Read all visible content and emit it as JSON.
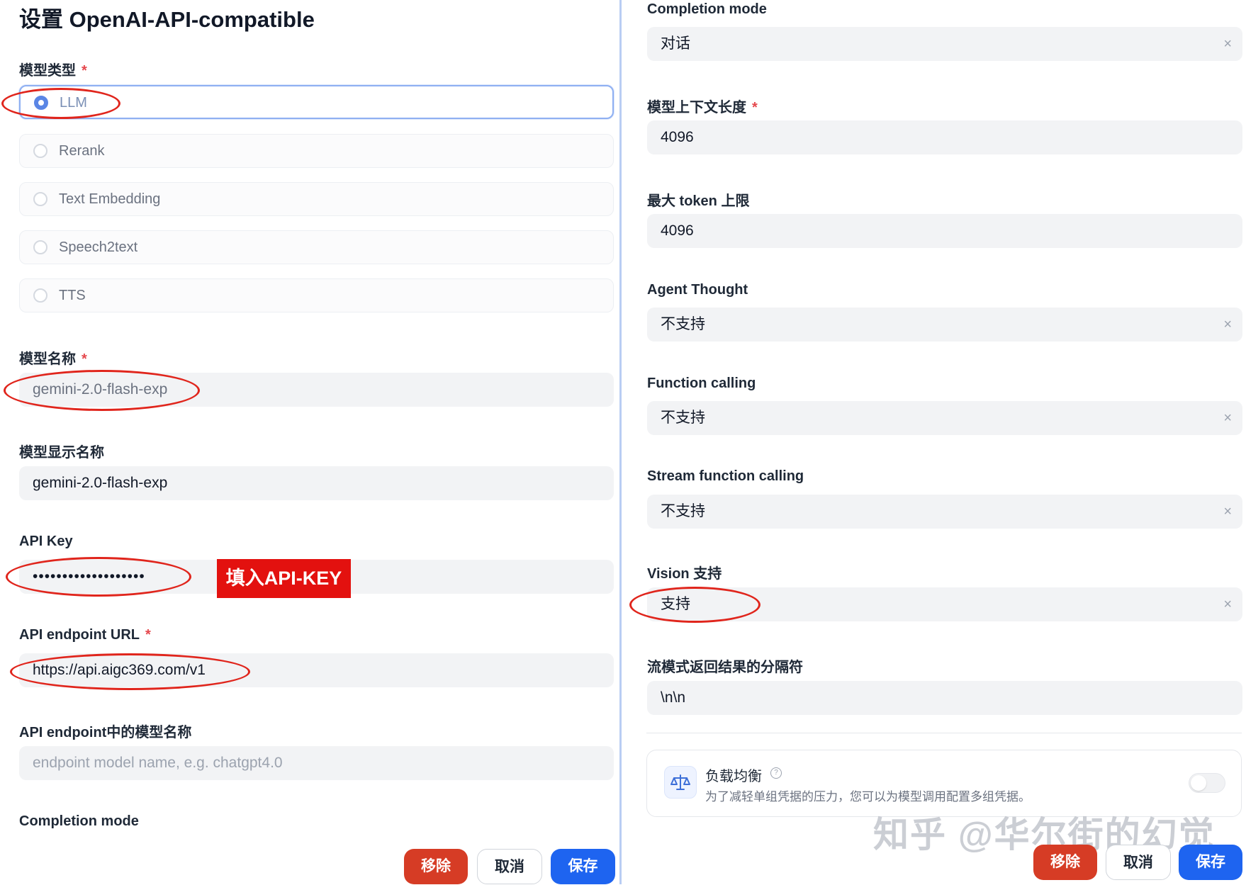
{
  "left": {
    "title": "设置 OpenAI-API-compatible",
    "model_type": {
      "label": "模型类型",
      "options": [
        {
          "label": "LLM",
          "selected": true
        },
        {
          "label": "Rerank",
          "selected": false
        },
        {
          "label": "Text Embedding",
          "selected": false
        },
        {
          "label": "Speech2text",
          "selected": false
        },
        {
          "label": "TTS",
          "selected": false
        }
      ]
    },
    "model_name": {
      "label": "模型名称",
      "value": "gemini-2.0-flash-exp"
    },
    "display_name": {
      "label": "模型显示名称",
      "value": "gemini-2.0-flash-exp"
    },
    "api_key": {
      "label": "API Key",
      "value": "•••••••••••••••••••",
      "callout": "填入API-KEY"
    },
    "endpoint_url": {
      "label": "API endpoint URL",
      "value": "https://api.aigc369.com/v1"
    },
    "endpoint_model": {
      "label": "API endpoint中的模型名称",
      "placeholder": "endpoint model name, e.g. chatgpt4.0"
    },
    "completion_mode_label": "Completion mode",
    "buttons": {
      "remove": "移除",
      "cancel": "取消",
      "save": "保存"
    }
  },
  "right": {
    "completion_mode": {
      "label": "Completion mode",
      "value": "对话"
    },
    "context_length": {
      "label": "模型上下文长度",
      "value": "4096"
    },
    "max_tokens": {
      "label": "最大 token 上限",
      "value": "4096"
    },
    "agent_thought": {
      "label": "Agent Thought",
      "value": "不支持"
    },
    "function_calling": {
      "label": "Function calling",
      "value": "不支持"
    },
    "stream_function_calling": {
      "label": "Stream function calling",
      "value": "不支持"
    },
    "vision": {
      "label": "Vision 支持",
      "value": "支持"
    },
    "stream_delimiter": {
      "label": "流模式返回结果的分隔符",
      "value": "\\n\\n"
    },
    "load_balance": {
      "title": "负载均衡",
      "help": "?",
      "description": "为了减轻单组凭据的压力，您可以为模型调用配置多组凭据。",
      "enabled": false
    },
    "buttons": {
      "remove": "移除",
      "cancel": "取消",
      "save": "保存"
    },
    "required_mark": "*",
    "clear_symbol": "×"
  },
  "watermark": "知乎 @华尔街的幻觉",
  "colors": {
    "accent": "#1e64f0",
    "danger": "#d63c25",
    "annotation": "#e0251c",
    "radio_selected": "#5b86e5"
  },
  "icons": [
    "radio-selected-icon",
    "clear-icon",
    "scale-balance-icon",
    "help-circle-icon"
  ]
}
